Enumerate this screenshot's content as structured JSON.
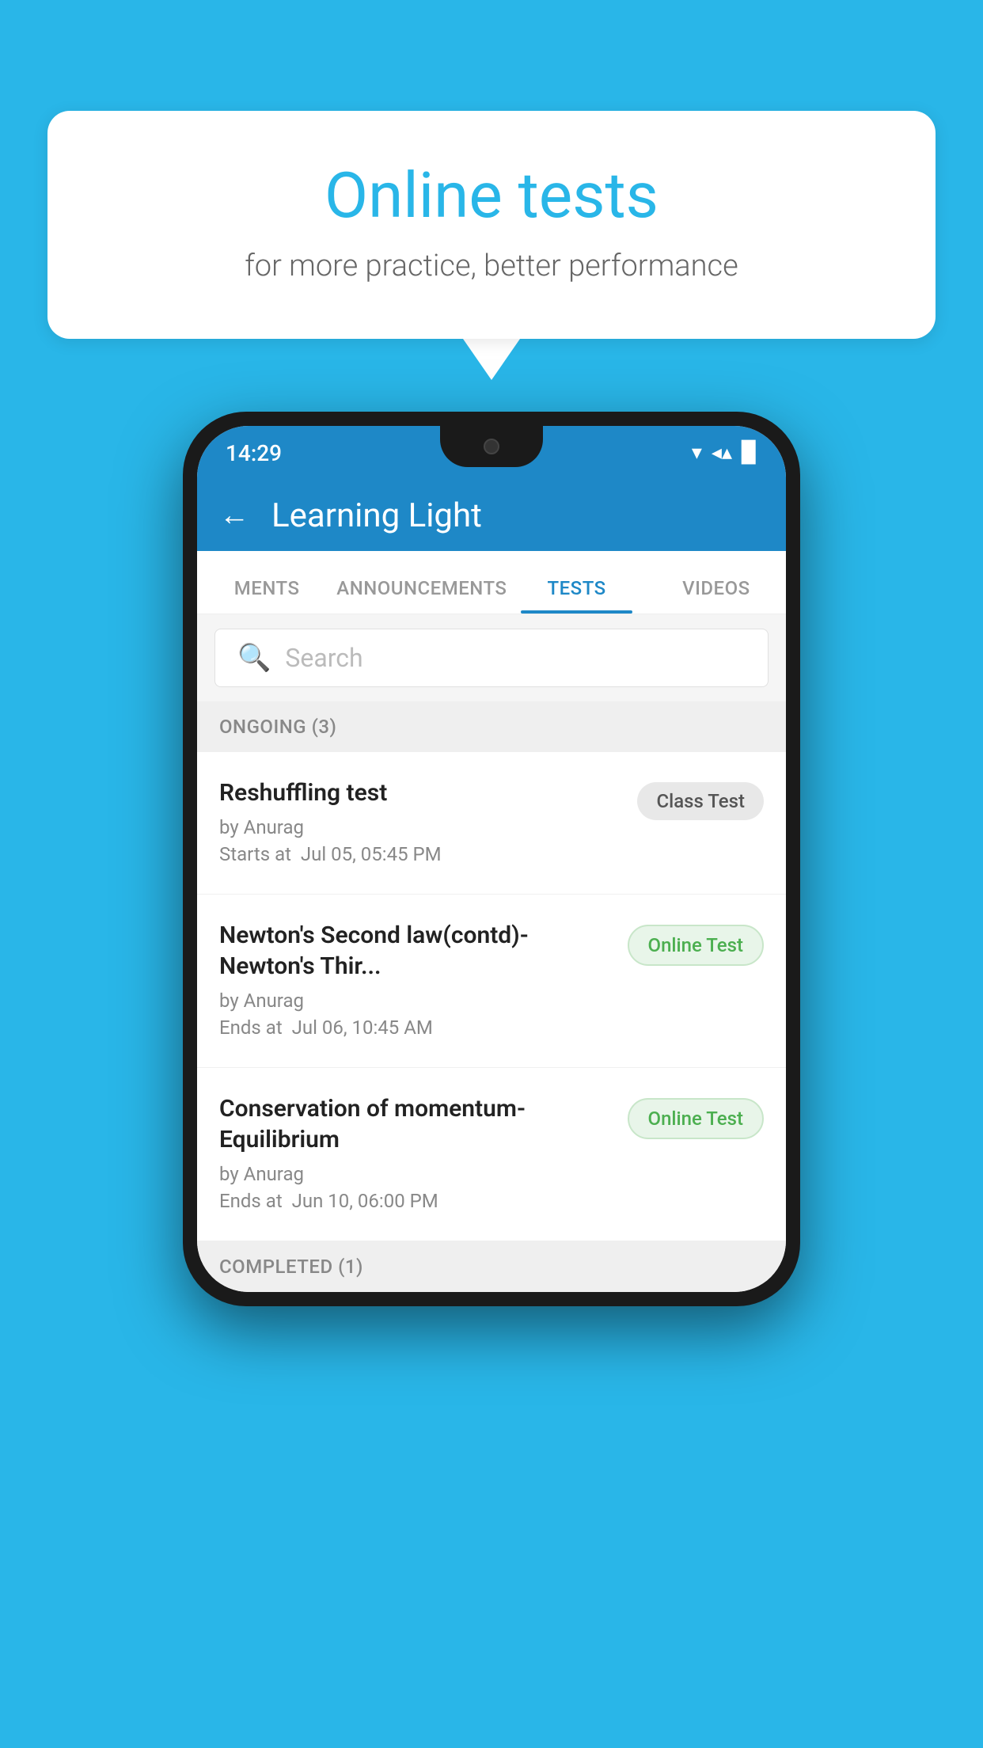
{
  "background": {
    "color": "#29b6e8"
  },
  "speech_bubble": {
    "title": "Online tests",
    "subtitle": "for more practice, better performance"
  },
  "status_bar": {
    "time": "14:29",
    "wifi": "▾",
    "signal": "▲",
    "battery": "▉"
  },
  "app_bar": {
    "back_label": "←",
    "title": "Learning Light"
  },
  "tabs": [
    {
      "label": "MENTS",
      "active": false
    },
    {
      "label": "ANNOUNCEMENTS",
      "active": false
    },
    {
      "label": "TESTS",
      "active": true
    },
    {
      "label": "VIDEOS",
      "active": false
    }
  ],
  "search": {
    "placeholder": "Search"
  },
  "ongoing_section": {
    "label": "ONGOING (3)"
  },
  "tests": [
    {
      "title": "Reshuffling test",
      "author": "by Anurag",
      "time_label": "Starts at",
      "time": "Jul 05, 05:45 PM",
      "badge": "Class Test",
      "badge_type": "class"
    },
    {
      "title": "Newton's Second law(contd)-Newton's Thir...",
      "author": "by Anurag",
      "time_label": "Ends at",
      "time": "Jul 06, 10:45 AM",
      "badge": "Online Test",
      "badge_type": "online"
    },
    {
      "title": "Conservation of momentum-Equilibrium",
      "author": "by Anurag",
      "time_label": "Ends at",
      "time": "Jun 10, 06:00 PM",
      "badge": "Online Test",
      "badge_type": "online"
    }
  ],
  "completed_section": {
    "label": "COMPLETED (1)"
  }
}
